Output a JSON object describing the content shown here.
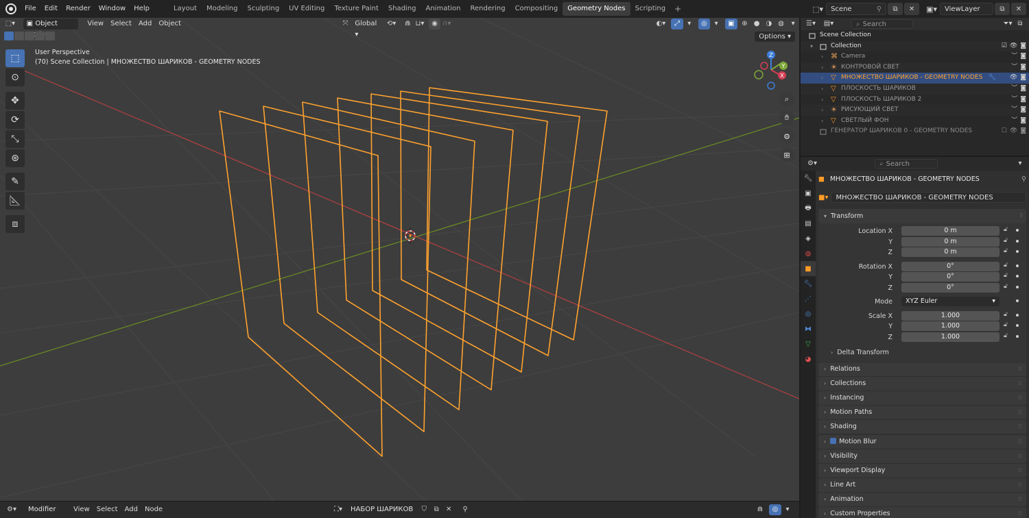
{
  "menu": {
    "items": [
      "File",
      "Edit",
      "Render",
      "Window",
      "Help"
    ]
  },
  "workspaces": {
    "tabs": [
      "Layout",
      "Modeling",
      "Sculpting",
      "UV Editing",
      "Texture Paint",
      "Shading",
      "Animation",
      "Rendering",
      "Compositing",
      "Geometry Nodes",
      "Scripting"
    ],
    "active": "Geometry Nodes",
    "add": "+"
  },
  "topright": {
    "scene": "Scene",
    "viewlayer": "ViewLayer"
  },
  "viewport": {
    "mode": "Object Mode",
    "menus": [
      "View",
      "Select",
      "Add",
      "Object"
    ],
    "orientation": "Global",
    "options": "Options",
    "perspective": "User Perspective",
    "collection_line": "(70) Scene Collection | МНОЖЕСТВО ШАРИКОВ - GEOMETRY NODES",
    "gizmo": {
      "x": "X",
      "y": "Y",
      "z": "Z"
    }
  },
  "bottombar": {
    "editor_mode": "Modifier",
    "menus": [
      "View",
      "Select",
      "Add",
      "Node"
    ],
    "node_group": "НАБОР ШАРИКОВ"
  },
  "outliner": {
    "search_placeholder": "Search",
    "scene_collection": "Scene Collection",
    "collection": "Collection",
    "items": [
      {
        "name": "Camera",
        "type": "camera"
      },
      {
        "name": "КОНТРОВОЙ СВЕТ",
        "type": "light"
      },
      {
        "name": "МНОЖЕСТВО ШАРИКОВ - GEOMETRY NODES",
        "type": "mesh",
        "selected": true
      },
      {
        "name": "ПЛОСКОСТЬ ШАРИКОВ",
        "type": "mesh"
      },
      {
        "name": "ПЛОСКОСТЬ ШАРИКОВ 2",
        "type": "mesh"
      },
      {
        "name": "РИСУЮЩИЙ СВЕТ",
        "type": "light"
      },
      {
        "name": "СВЕТЛЫЙ ФОН",
        "type": "mesh"
      }
    ],
    "generator": "ГЕНЕРАТОР ШАРИКОВ 0 - GEOMETRY NODES"
  },
  "properties": {
    "search_placeholder": "Search",
    "object_title": "МНОЖЕСТВО ШАРИКОВ - GEOMETRY NODES",
    "object_name": "МНОЖЕСТВО ШАРИКОВ - GEOMETRY NODES",
    "transform": {
      "title": "Transform",
      "location_label": "Location X",
      "location": [
        "0 m",
        "0 m",
        "0 m"
      ],
      "rotation_label": "Rotation X",
      "rotation": [
        "0°",
        "0°",
        "0°"
      ],
      "mode_label": "Mode",
      "mode": "XYZ Euler",
      "scale_label": "Scale X",
      "scale": [
        "1.000",
        "1.000",
        "1.000"
      ],
      "y": "Y",
      "z": "Z",
      "delta": "Delta Transform"
    },
    "panels": [
      "Relations",
      "Collections",
      "Instancing",
      "Motion Paths",
      "Shading",
      "Motion Blur",
      "Visibility",
      "Viewport Display",
      "Line Art",
      "Animation",
      "Custom Properties"
    ]
  },
  "colors": {
    "accent": "#4772b3",
    "selected_outline": "#ffa22e",
    "x_axis": "#b54040",
    "y_axis": "#6b8e23",
    "viewport_bg": "#3d3d3d"
  }
}
